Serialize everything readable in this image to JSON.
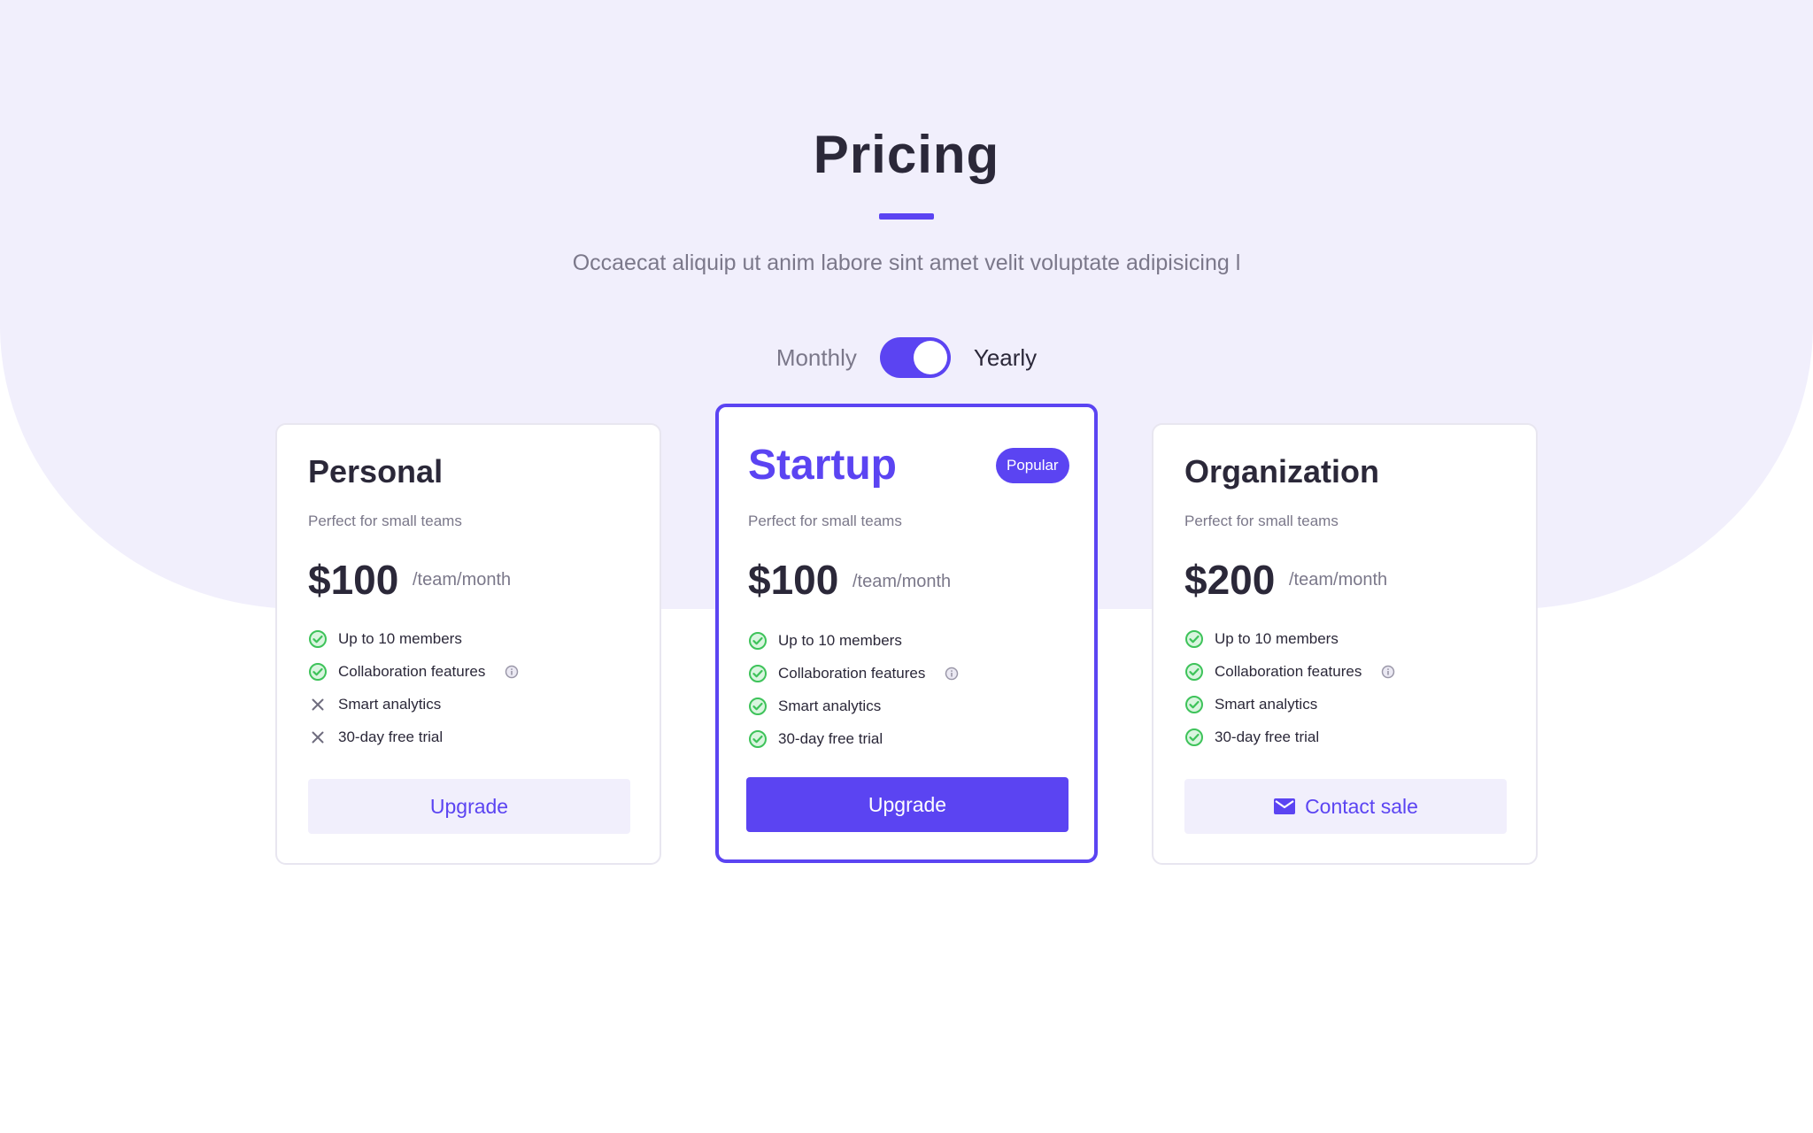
{
  "header": {
    "title": "Pricing",
    "subtitle": "Occaecat aliquip ut anim labore sint amet velit voluptate adipisicing l"
  },
  "billing": {
    "monthly_label": "Monthly",
    "yearly_label": "Yearly",
    "selected": "Yearly"
  },
  "colors": {
    "accent": "#5b44f2",
    "hero_bg": "#f1effc",
    "check_green": "#3ec35a",
    "text_dark": "#2b2839",
    "text_muted": "#7b788a"
  },
  "plans": [
    {
      "name": "Personal",
      "description": "Perfect for small teams",
      "price": "$100",
      "price_unit": "/team/month",
      "features": [
        {
          "label": "Up to 10 members",
          "included": true,
          "icon": "check-circle-icon"
        },
        {
          "label": "Collaboration features",
          "included": true,
          "icon": "check-circle-icon",
          "info": true
        },
        {
          "label": "Smart analytics",
          "included": false,
          "icon": "x-icon"
        },
        {
          "label": "30-day free trial",
          "included": false,
          "icon": "x-icon"
        }
      ],
      "button_label": "Upgrade"
    },
    {
      "name": "Startup",
      "badge": "Popular",
      "description": "Perfect for small teams",
      "price": "$100",
      "price_unit": "/team/month",
      "features": [
        {
          "label": "Up to 10 members",
          "included": true,
          "icon": "check-circle-icon"
        },
        {
          "label": "Collaboration features",
          "included": true,
          "icon": "check-circle-icon",
          "info": true
        },
        {
          "label": "Smart analytics",
          "included": true,
          "icon": "check-circle-icon"
        },
        {
          "label": "30-day free trial",
          "included": true,
          "icon": "check-circle-icon"
        }
      ],
      "button_label": "Upgrade"
    },
    {
      "name": "Organization",
      "description": "Perfect for small teams",
      "price": "$200",
      "price_unit": "/team/month",
      "features": [
        {
          "label": "Up to 10 members",
          "included": true,
          "icon": "check-circle-icon"
        },
        {
          "label": "Collaboration features",
          "included": true,
          "icon": "check-circle-icon",
          "info": true
        },
        {
          "label": "Smart analytics",
          "included": true,
          "icon": "check-circle-icon"
        },
        {
          "label": "30-day free trial",
          "included": true,
          "icon": "check-circle-icon"
        }
      ],
      "button_label": "Contact sale",
      "button_icon": "mail-icon"
    }
  ]
}
